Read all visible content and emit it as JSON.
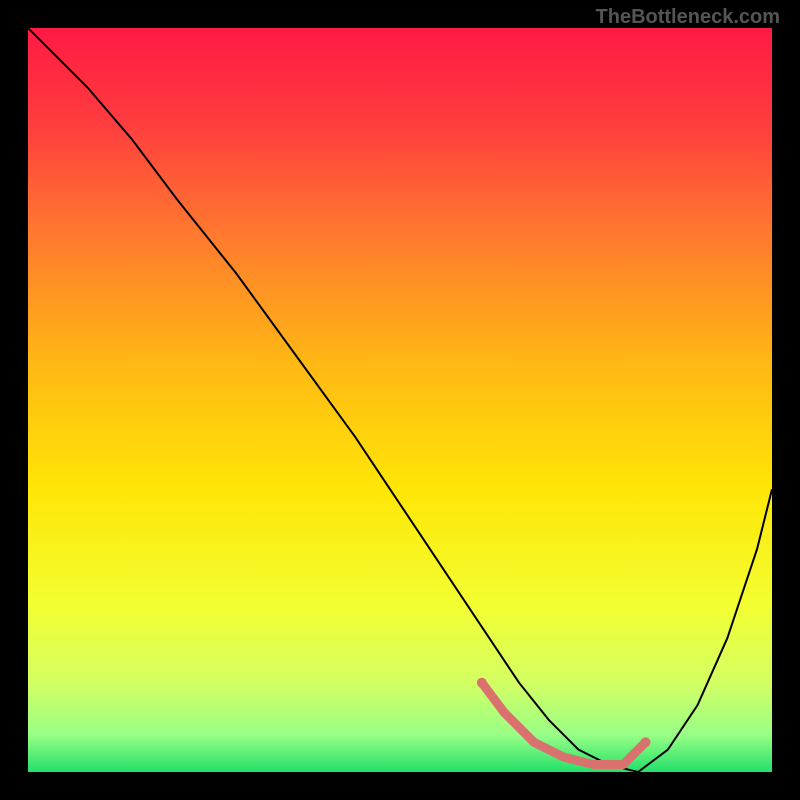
{
  "watermark": "TheBottleneck.com",
  "chart_data": {
    "type": "line",
    "title": "",
    "xlabel": "",
    "ylabel": "",
    "xlim": [
      0,
      100
    ],
    "ylim": [
      0,
      100
    ],
    "background_gradient": {
      "stops": [
        {
          "offset": 0.0,
          "color": "#ff1a44"
        },
        {
          "offset": 0.12,
          "color": "#ff3a3f"
        },
        {
          "offset": 0.28,
          "color": "#ff7a2e"
        },
        {
          "offset": 0.45,
          "color": "#ffb814"
        },
        {
          "offset": 0.62,
          "color": "#ffe606"
        },
        {
          "offset": 0.78,
          "color": "#f2ff33"
        },
        {
          "offset": 0.88,
          "color": "#d3ff63"
        },
        {
          "offset": 0.95,
          "color": "#98ff86"
        },
        {
          "offset": 1.0,
          "color": "#22e06a"
        }
      ]
    },
    "series": [
      {
        "name": "bottleneck-curve",
        "stroke": "#000000",
        "stroke_width": 2,
        "x": [
          0,
          4,
          8,
          14,
          20,
          28,
          36,
          44,
          52,
          58,
          62,
          66,
          70,
          74,
          78,
          82,
          86,
          90,
          94,
          98,
          100
        ],
        "y": [
          100,
          96,
          92,
          85,
          77,
          67,
          56,
          45,
          33,
          24,
          18,
          12,
          7,
          3,
          1,
          0,
          3,
          9,
          18,
          30,
          38
        ]
      }
    ],
    "highlight_segment": {
      "name": "optimal-range",
      "stroke": "#d9716f",
      "stroke_width": 9,
      "x": [
        61,
        64,
        68,
        72,
        76,
        80,
        83
      ],
      "y": [
        12,
        8,
        4,
        2,
        1,
        1,
        4
      ],
      "endpoints": [
        {
          "x": 61,
          "y": 12,
          "r": 5
        },
        {
          "x": 83,
          "y": 4,
          "r": 5
        }
      ]
    }
  }
}
